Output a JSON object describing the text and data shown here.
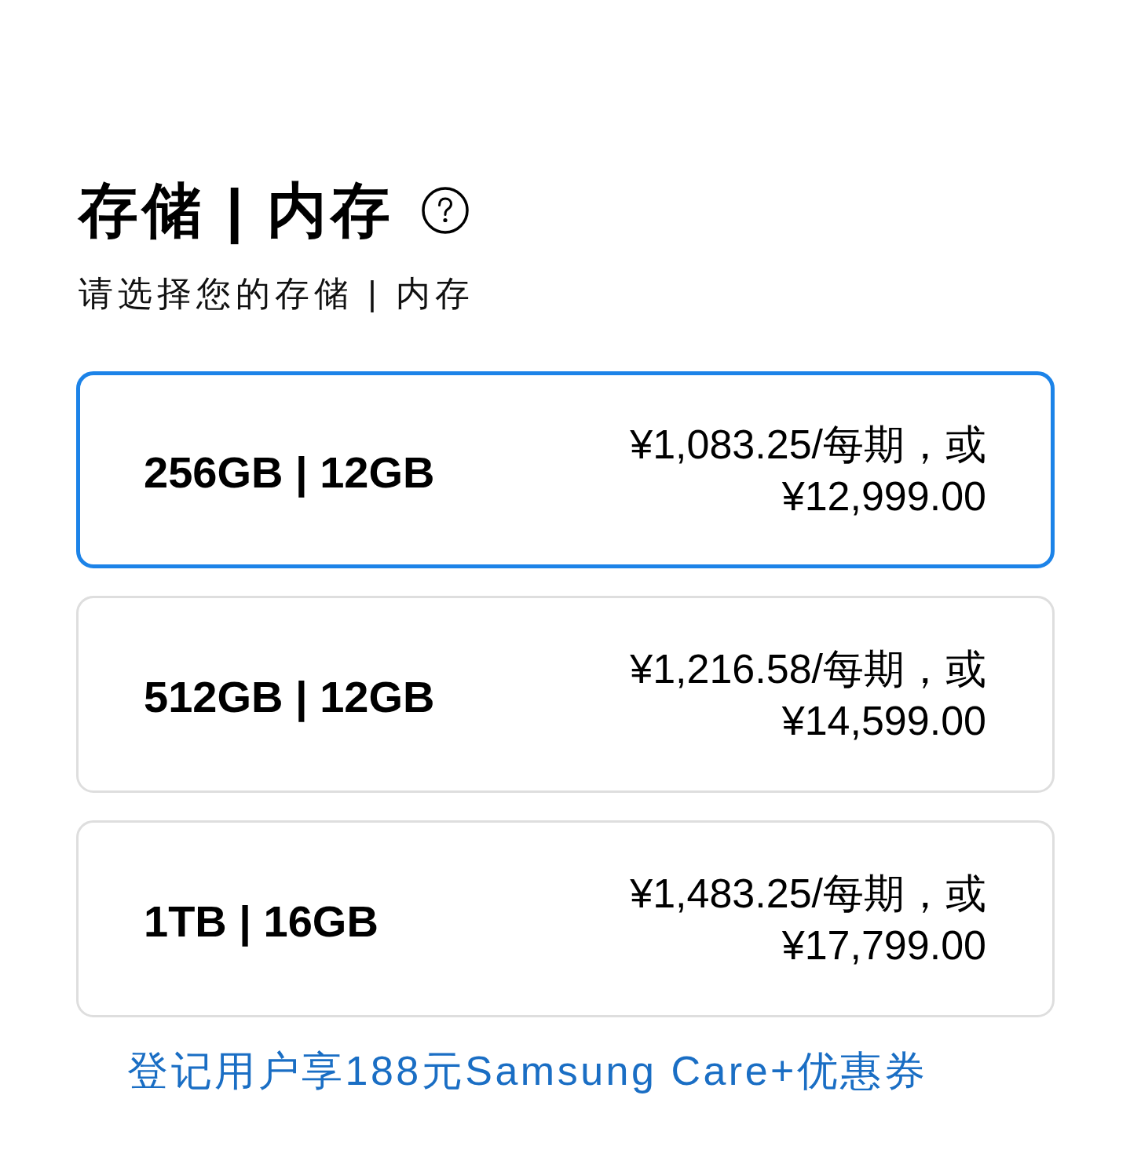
{
  "header": {
    "title": "存储 | 内存",
    "subtitle": "请选择您的存储 | 内存"
  },
  "options": [
    {
      "label": "256GB | 12GB",
      "price_monthly": "¥1,083.25/每期，或",
      "price_total": "¥12,999.00",
      "selected": true
    },
    {
      "label": "512GB | 12GB",
      "price_monthly": "¥1,216.58/每期，或",
      "price_total": "¥14,599.00",
      "selected": false
    },
    {
      "label": "1TB | 16GB",
      "price_monthly": "¥1,483.25/每期，或",
      "price_total": "¥17,799.00",
      "selected": false
    }
  ],
  "promo_link": "登记用户享188元Samsung Care+优惠券"
}
